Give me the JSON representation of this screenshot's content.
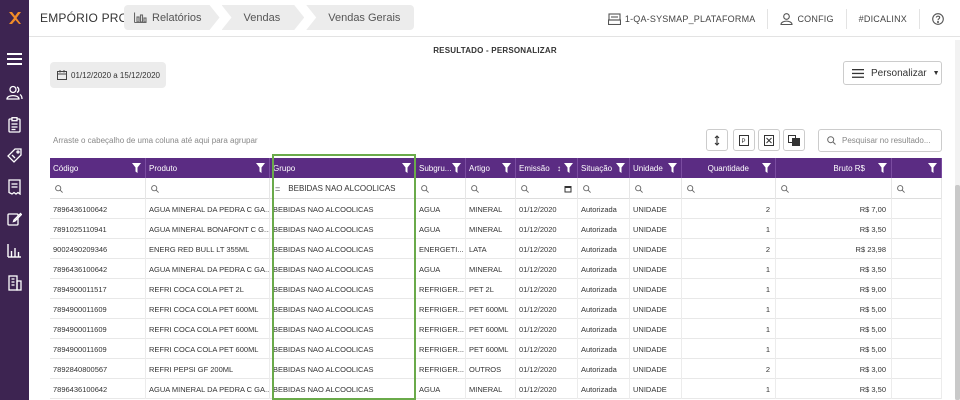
{
  "app": {
    "title": "EMPÓRIO PRO"
  },
  "breadcrumbs": [
    "Relatórios",
    "Vendas",
    "Vendas Gerais"
  ],
  "topbar": {
    "platform": "1-QA-SYSMAP_PLATAFORMA",
    "config": "CONFIG",
    "hashtag": "#DICALINX"
  },
  "page": {
    "title": "RESULTADO - PERSONALIZAR",
    "date_range": "01/12/2020 a 15/12/2020",
    "personalizar_label": "Personalizar",
    "group_hint": "Arraste o cabeçalho de uma coluna até aqui para agrupar",
    "search_placeholder": "Pesquisar no resultado..."
  },
  "grid": {
    "headers": [
      "Código",
      "Produto",
      "Grupo",
      "Subgru...",
      "Artigo",
      "Emissão",
      "Situação",
      "Unidade",
      "Quantidade",
      "Bruto R$",
      ""
    ],
    "filter_grupo_value": "BEBIDAS NAO ALCOOLICAS",
    "rows": [
      [
        "7896436100642",
        "AGUA MINERAL DA PEDRA C GA...",
        "BEBIDAS NAO ALCOOLICAS",
        "AGUA",
        "MINERAL",
        "01/12/2020",
        "Autorizada",
        "UNIDADE",
        "2",
        "R$ 7,00"
      ],
      [
        "7891025110941",
        "AGUA MINERAL BONAFONT C G...",
        "BEBIDAS NAO ALCOOLICAS",
        "AGUA",
        "MINERAL",
        "01/12/2020",
        "Autorizada",
        "UNIDADE",
        "1",
        "R$ 3,50"
      ],
      [
        "9002490209346",
        "ENERG RED BULL LT 355ML",
        "BEBIDAS NAO ALCOOLICAS",
        "ENERGETI...",
        "LATA",
        "01/12/2020",
        "Autorizada",
        "UNIDADE",
        "2",
        "R$ 23,98"
      ],
      [
        "7896436100642",
        "AGUA MINERAL DA PEDRA C GA...",
        "BEBIDAS NAO ALCOOLICAS",
        "AGUA",
        "MINERAL",
        "01/12/2020",
        "Autorizada",
        "UNIDADE",
        "1",
        "R$ 3,50"
      ],
      [
        "7894900011517",
        "REFRI COCA COLA PET 2L",
        "BEBIDAS NAO ALCOOLICAS",
        "REFRIGER...",
        "PET 2L",
        "01/12/2020",
        "Autorizada",
        "UNIDADE",
        "1",
        "R$ 9,00"
      ],
      [
        "7894900011609",
        "REFRI COCA COLA PET 600ML",
        "BEBIDAS NAO ALCOOLICAS",
        "REFRIGER...",
        "PET 600ML",
        "01/12/2020",
        "Autorizada",
        "UNIDADE",
        "1",
        "R$ 5,00"
      ],
      [
        "7894900011609",
        "REFRI COCA COLA PET 600ML",
        "BEBIDAS NAO ALCOOLICAS",
        "REFRIGER...",
        "PET 600ML",
        "01/12/2020",
        "Autorizada",
        "UNIDADE",
        "1",
        "R$ 5,00"
      ],
      [
        "7894900011609",
        "REFRI COCA COLA PET 600ML",
        "BEBIDAS NAO ALCOOLICAS",
        "REFRIGER...",
        "PET 600ML",
        "01/12/2020",
        "Autorizada",
        "UNIDADE",
        "1",
        "R$ 5,00"
      ],
      [
        "7892840800567",
        "REFRI PEPSI GF 200ML",
        "BEBIDAS NAO ALCOOLICAS",
        "REFRIGER...",
        "OUTROS",
        "01/12/2020",
        "Autorizada",
        "UNIDADE",
        "2",
        "R$ 3,00"
      ],
      [
        "7896436100642",
        "AGUA MINERAL DA PEDRA C GA...",
        "BEBIDAS NAO ALCOOLICAS",
        "AGUA",
        "MINERAL",
        "01/12/2020",
        "Autorizada",
        "UNIDADE",
        "1",
        "R$ 3,50"
      ]
    ]
  },
  "icons": {
    "sidebar": [
      "menu-icon",
      "users-icon",
      "clipboard-icon",
      "tag-icon",
      "receipt-icon",
      "edit-icon",
      "chart-icon",
      "building-icon"
    ]
  },
  "colors": {
    "sidebar": "#3d2451",
    "header": "#5b2c83",
    "logo": "#f28c28",
    "highlight": "#6aaa4a"
  }
}
